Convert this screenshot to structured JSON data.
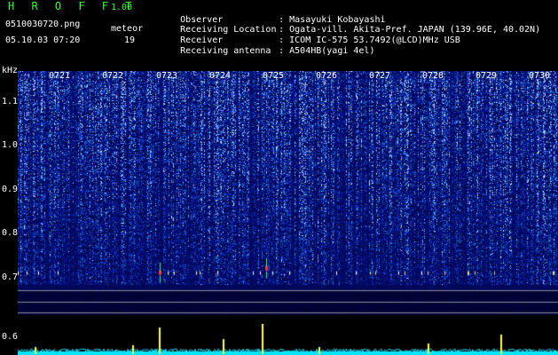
{
  "header": {
    "app_name": "HROFFT",
    "version": "1.00",
    "filename": "0510030720.png",
    "meteor_label": "meteor",
    "meteor_count": "19",
    "datetime": "05.10.03 07:20",
    "observer_label": "Observer",
    "observer": ": Masayuki Kobayashi",
    "location_label": "Receiving Location",
    "location": ": Ogata-vill. Akita-Pref. JAPAN (139.96E, 40.02N)",
    "receiver_label": "Receiver",
    "receiver": ": ICOM IC-575 53.7492(@LCD)MHz USB",
    "antenna_label": "Receiving antenna",
    "antenna": ": A504HB(yagi 4el)"
  },
  "colors": {
    "logo": "#33ff33",
    "background": "#000000",
    "spectrum_base": "#050a5a",
    "trace": "#00e5ff",
    "peak": "#ffff33"
  },
  "chart_data": {
    "type": "heatmap",
    "title": "",
    "ylabel": "kHz",
    "yunit": "kHz",
    "y_ticks": [
      "1.1",
      "1.0",
      "0.9",
      "0.8",
      "0.7",
      "0.6"
    ],
    "x_ticks": [
      "0721",
      "0722",
      "0723",
      "0724",
      "0725",
      "0726",
      "0727",
      "0728",
      "0729",
      "0730"
    ],
    "xlim": [
      "0720",
      "0730"
    ],
    "meteor_echoes": [
      {
        "time": "0723",
        "freq_khz": 0.71
      },
      {
        "time": "0725",
        "freq_khz": 0.72
      }
    ]
  }
}
